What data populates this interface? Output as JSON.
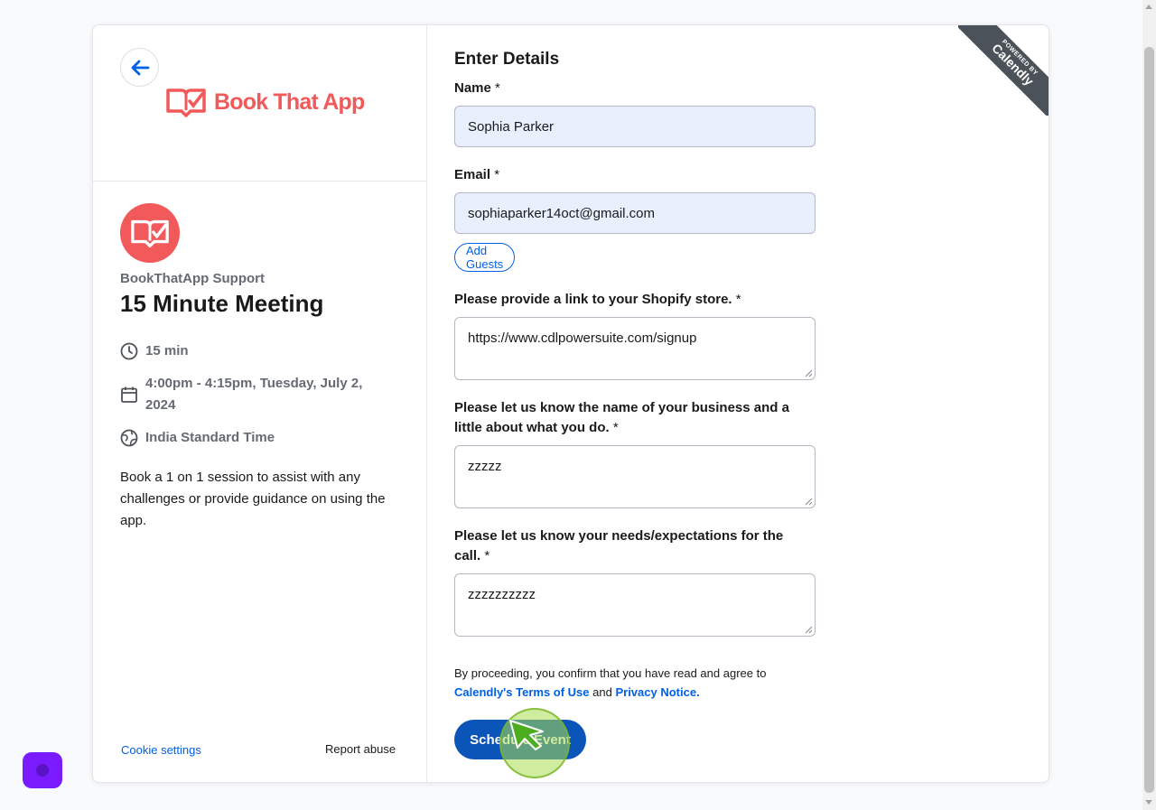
{
  "brand": {
    "name": "Book That App",
    "color": "#f1595a"
  },
  "event": {
    "owner": "BookThatApp Support",
    "title": "15 Minute Meeting",
    "duration": "15 min",
    "datetime_line1": "4:00pm - 4:15pm, Tuesday, July 2,",
    "datetime_line2": "2024",
    "timezone": "India Standard Time",
    "description": "Book a 1 on 1 session to assist with any challenges or provide guidance on using the app."
  },
  "footer": {
    "cookie_settings": "Cookie settings",
    "report_abuse": "Report abuse"
  },
  "form": {
    "title": "Enter Details",
    "name_label": "Name",
    "name_value": "Sophia Parker",
    "email_label": "Email",
    "email_value": "sophiaparker14oct@gmail.com",
    "required_mark": " *",
    "add_guests": "Add Guests",
    "q1_label": "Please provide a link to your Shopify store.",
    "q1_value": "https://www.cdlpowersuite.com/signup",
    "q2_label": "Please let us know the name of your business and a little about what you do.",
    "q2_value": "zzzzz",
    "q3_label": "Please let us know your needs/expectations for the call.",
    "q3_value": "zzzzzzzzzz",
    "legal_text": "By proceeding, you confirm that you have read and agree to",
    "terms_link": "Calendly's Terms of Use",
    "and": "and",
    "privacy_link": "Privacy Notice.",
    "submit": "Schedule Event"
  },
  "ribbon": {
    "small": "POWERED BY",
    "big": "Calendly"
  },
  "colors": {
    "accent": "#0060e6",
    "button": "#0b55b8",
    "widget": "#7a1bff"
  }
}
